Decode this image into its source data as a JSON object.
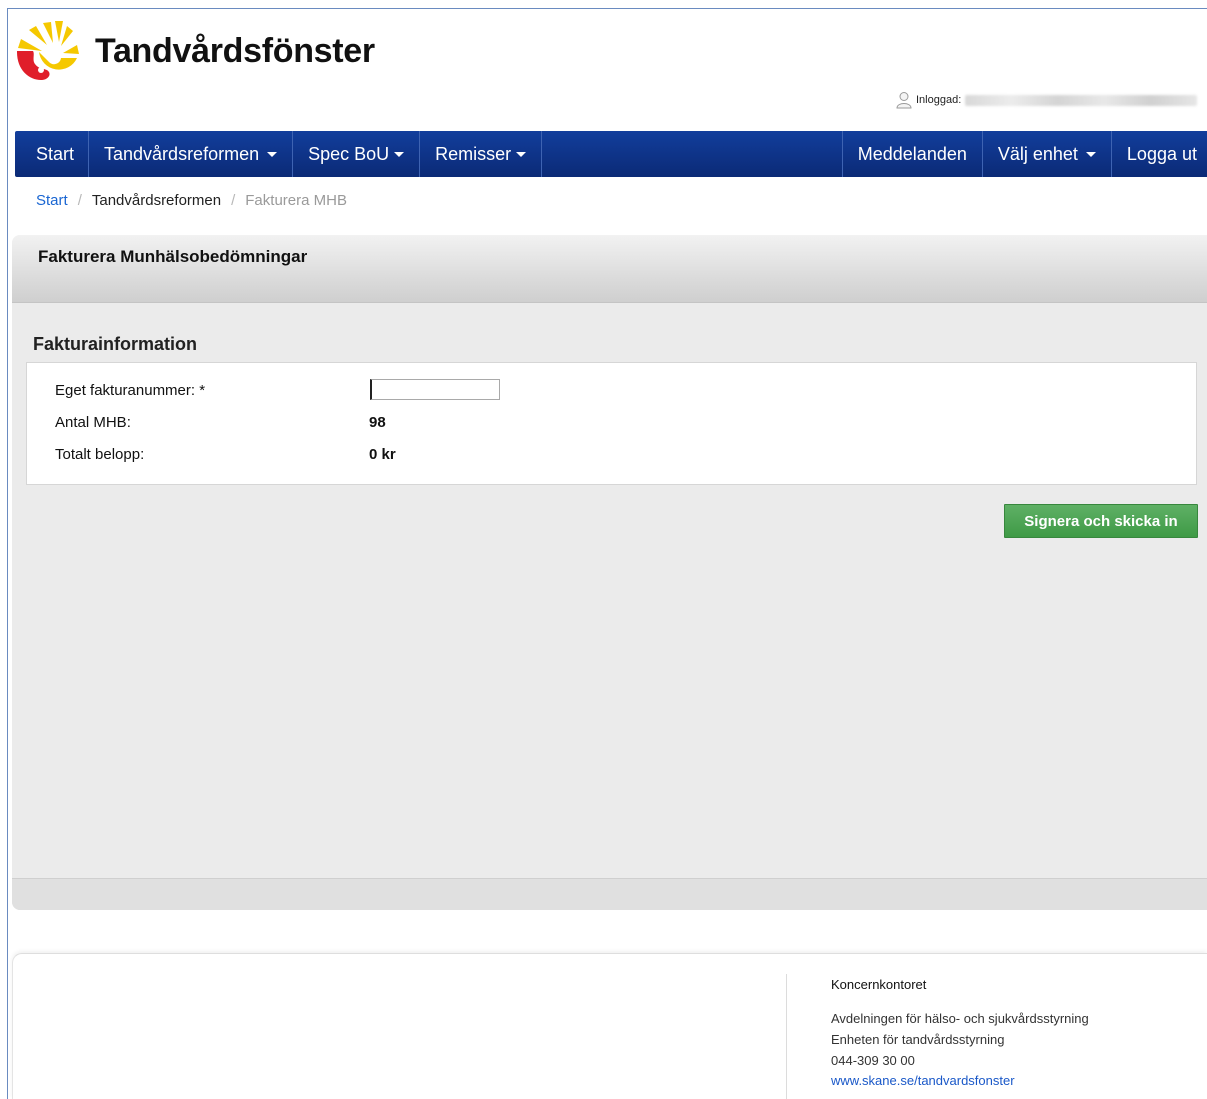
{
  "header": {
    "title": "Tandvårdsfönster",
    "logged_in_label": "Inloggad:"
  },
  "nav": {
    "left": [
      "Start",
      "Tandvårdsreformen",
      "Spec BoU",
      "Remisser"
    ],
    "right": [
      "Meddelanden",
      "Välj enhet",
      "Logga ut"
    ]
  },
  "breadcrumb": {
    "items": [
      "Start",
      "Tandvårdsreformen",
      "Fakturera MHB"
    ],
    "separator": "/"
  },
  "page": {
    "title": "Fakturera Munhälsobedömningar",
    "section_title": "Fakturainformation",
    "fields": {
      "invoice_number_label": "Eget fakturanummer: *",
      "invoice_number_value": "",
      "count_label": "Antal MHB:",
      "count_value": "98",
      "total_label": "Totalt belopp:",
      "total_value": "0 kr"
    },
    "submit_label": "Signera och skicka in"
  },
  "footer": {
    "org": "Koncernkontoret",
    "lines": [
      "Avdelningen för hälso- och sjukvårdsstyrning",
      "Enheten för tandvårdsstyrning",
      "044-309 30 00"
    ],
    "link": "www.skane.se/tandvardsfonster"
  },
  "colors": {
    "nav_bg": "#0b2a76",
    "link": "#1a66d2",
    "submit_bg": "#43a04a",
    "panel_bg": "#ebebeb"
  }
}
